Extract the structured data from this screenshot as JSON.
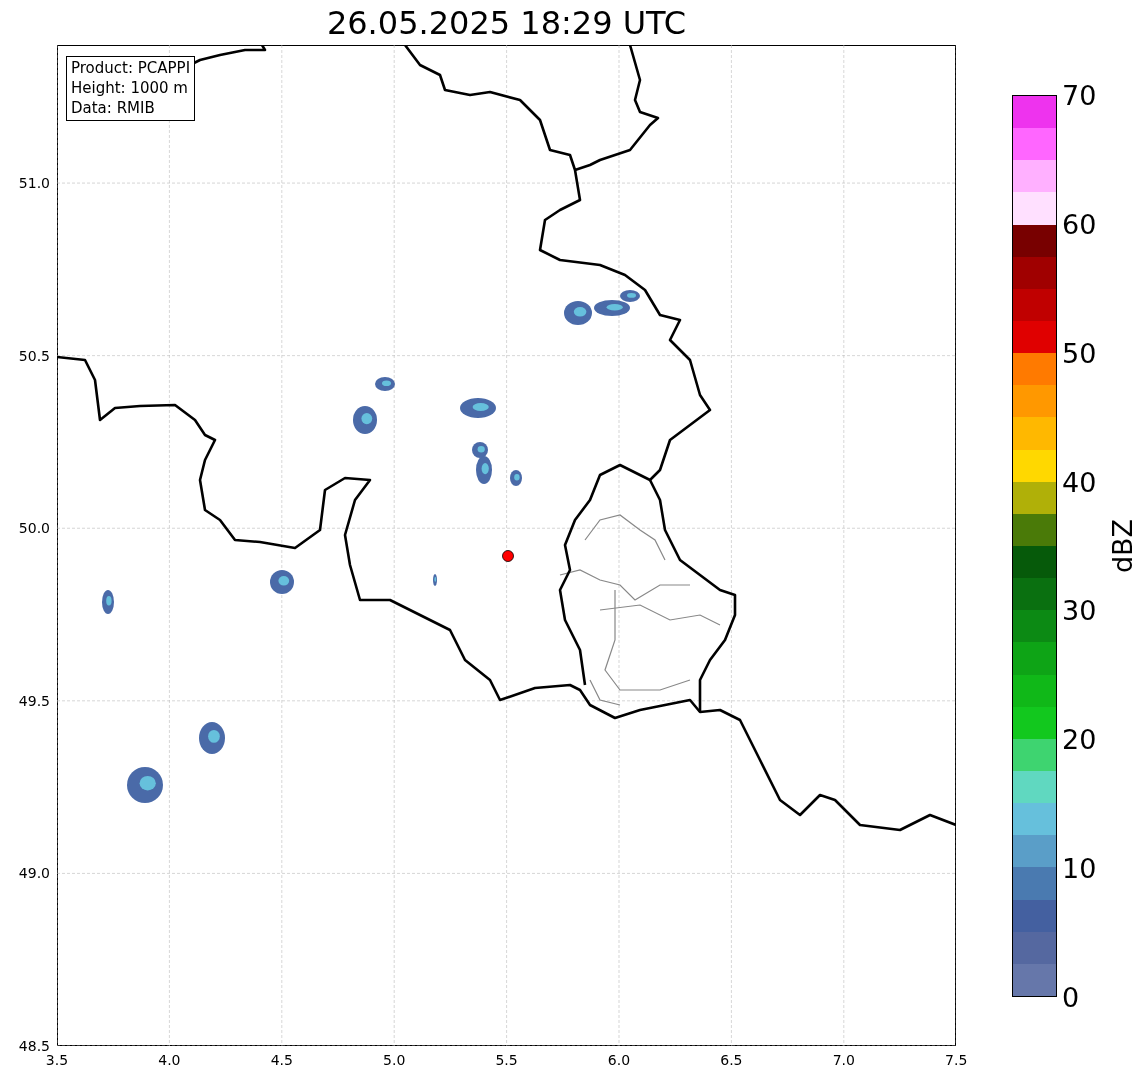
{
  "title": "26.05.2025 18:29 UTC",
  "info_box": [
    "Product: PCAPPI",
    "Height: 1000 m",
    "Data: RMIB"
  ],
  "map": {
    "x_ticks": [
      "3.5",
      "4.0",
      "4.5",
      "5.0",
      "5.5",
      "6.0",
      "6.5",
      "7.0",
      "7.5"
    ],
    "y_ticks": [
      "51.0",
      "50.5",
      "50.0",
      "49.5",
      "49.0",
      "48.5"
    ]
  },
  "colorbar": {
    "label": "dBZ",
    "ticks": [
      "70",
      "60",
      "50",
      "40",
      "30",
      "20",
      "10",
      "0"
    ],
    "segments": [
      {
        "color": "#6677aa"
      },
      {
        "color": "#5568a0"
      },
      {
        "color": "#4460a0"
      },
      {
        "color": "#4a7ab0"
      },
      {
        "color": "#5a9ec8"
      },
      {
        "color": "#66c0dc"
      },
      {
        "color": "#60d8c0"
      },
      {
        "color": "#3ed470"
      },
      {
        "color": "#12c81e"
      },
      {
        "color": "#10b818"
      },
      {
        "color": "#0ea416"
      },
      {
        "color": "#0c8a14"
      },
      {
        "color": "#0a7010"
      },
      {
        "color": "#065a0a"
      },
      {
        "color": "#4a7a08"
      },
      {
        "color": "#b0b008"
      },
      {
        "color": "#ffd800"
      },
      {
        "color": "#ffb800"
      },
      {
        "color": "#ff9800"
      },
      {
        "color": "#ff7a00"
      },
      {
        "color": "#e00000"
      },
      {
        "color": "#c00000"
      },
      {
        "color": "#a00000"
      },
      {
        "color": "#780000"
      },
      {
        "color": "#ffe0ff"
      },
      {
        "color": "#ffb0ff"
      },
      {
        "color": "#ff66ff"
      },
      {
        "color": "#ee33ee"
      }
    ]
  }
}
